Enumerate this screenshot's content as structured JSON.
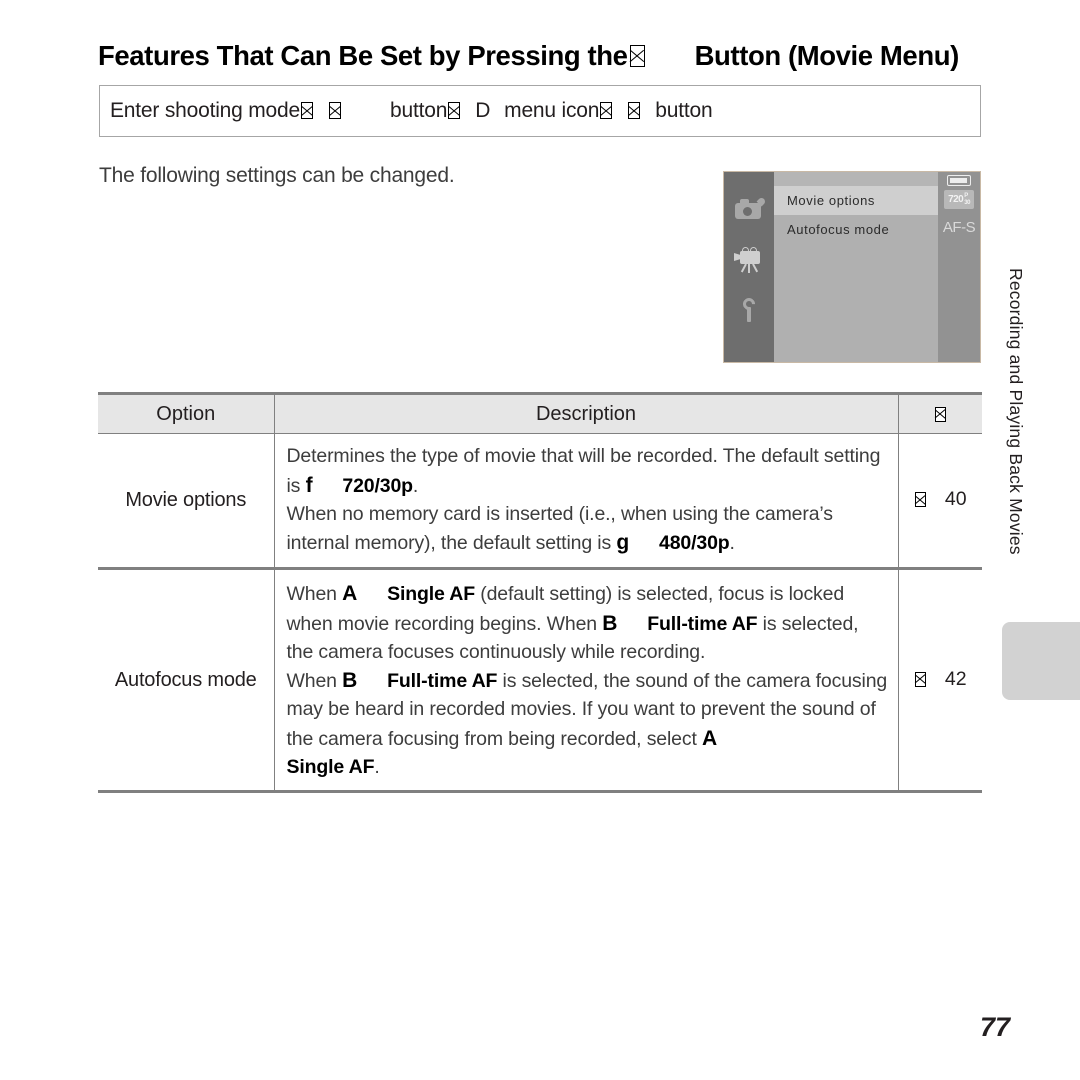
{
  "document": {
    "page_number": "77",
    "chapter_tab": "Recording and Playing Back Movies"
  },
  "title": {
    "before_icon": "Features That Can Be Set by Pressing the",
    "icon": "movie-menu-button-icon",
    "after_icon": "Button (Movie Menu)"
  },
  "instruction": {
    "part1": "Enter shooting mode",
    "arrow1": "right-arrow-icon",
    "icon1": "mode-dial-icon",
    "part2": "button",
    "arrow2": "right-arrow-icon",
    "letter_d": "D",
    "part3": "menu icon",
    "arrow3": "right-arrow-icon",
    "icon2": "ok-button-icon",
    "part4": "button"
  },
  "intro": {
    "text": "The following settings can be changed."
  },
  "camera_screen": {
    "sidebar_icons": [
      "camera-icon",
      "movie-camera-icon",
      "wrench-icon"
    ],
    "rows": [
      {
        "label": "Movie options",
        "selected": true,
        "value": "720",
        "value_sub_top": "P",
        "value_sub_bottom": "30"
      },
      {
        "label": "Autofocus mode",
        "selected": false,
        "value": "AF-S"
      }
    ],
    "battery_icon": "battery-icon"
  },
  "table": {
    "headers": {
      "option": "Option",
      "description": "Description",
      "reference": "page-reference-icon"
    },
    "rows": [
      {
        "option": "Movie options",
        "description_parts": [
          {
            "type": "text",
            "value": "Determines the type of movie that will be recorded. The default setting is "
          },
          {
            "type": "symbol",
            "value": "f"
          },
          {
            "type": "gap"
          },
          {
            "type": "bold",
            "value": "720/30p"
          },
          {
            "type": "text",
            "value": ". "
          },
          {
            "type": "break"
          },
          {
            "type": "text",
            "value": "When no memory card is inserted (i.e., when using the camera’s internal memory), the default setting is "
          },
          {
            "type": "symbol",
            "value": "g"
          },
          {
            "type": "gap"
          },
          {
            "type": "bold",
            "value": "480/30p"
          },
          {
            "type": "text",
            "value": "."
          }
        ],
        "reference_page": "40",
        "reference_icon": "page-reference-icon"
      },
      {
        "option": "Autofocus mode",
        "description_parts": [
          {
            "type": "text",
            "value": "When "
          },
          {
            "type": "symbol",
            "value": "A"
          },
          {
            "type": "gap"
          },
          {
            "type": "bold",
            "value": "Single AF"
          },
          {
            "type": "text",
            "value": " (default setting) is selected, focus is locked when movie recording begins. When "
          },
          {
            "type": "symbol",
            "value": "B"
          },
          {
            "type": "gap"
          },
          {
            "type": "bold",
            "value": "Full-time AF"
          },
          {
            "type": "text",
            "value": " is selected, the camera focuses continuously while recording. "
          },
          {
            "type": "break"
          },
          {
            "type": "text",
            "value": "When "
          },
          {
            "type": "symbol",
            "value": "B"
          },
          {
            "type": "gap"
          },
          {
            "type": "bold",
            "value": "Full-time AF"
          },
          {
            "type": "text",
            "value": " is selected, the sound of the camera focusing may be heard in recorded movies. If you want to prevent the sound of the camera focusing from being recorded, select "
          },
          {
            "type": "symbol",
            "value": "A"
          },
          {
            "type": "gap"
          },
          {
            "type": "bold",
            "value": "Single AF"
          },
          {
            "type": "text",
            "value": "."
          }
        ],
        "reference_page": "42",
        "reference_icon": "page-reference-icon"
      }
    ]
  }
}
